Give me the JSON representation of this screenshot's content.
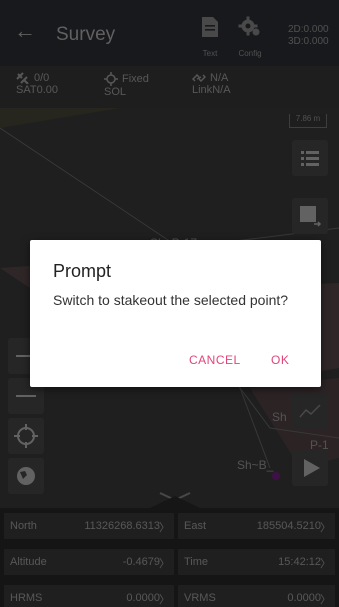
{
  "header": {
    "back_icon": "arrow-left-icon",
    "title": "Survey",
    "tools": [
      {
        "label": "Text",
        "icon": "document-icon"
      },
      {
        "label": "Config",
        "icon": "gear-icon"
      }
    ],
    "info_2d": "2D:0.000",
    "info_3d": "3D:0.000"
  },
  "status": {
    "sat_count": "0/0",
    "sat_label": "SAT",
    "sat_value": "0.00",
    "sol_state": "Fixed",
    "sol_label": "SOL",
    "link_value_top": "N/A",
    "link_label": "Link",
    "link_value": "N/A"
  },
  "map": {
    "scale": "7.86 m",
    "point_label_top": "Sh~P-17",
    "point_label_1": "Sh",
    "point_label_2": "P-1",
    "point_label_3": "Sh~B_",
    "colors": {
      "parcel_fill": "#5a4a4c",
      "point": "#7a1f8a"
    }
  },
  "dialog": {
    "title": "Prompt",
    "message": "Switch to stakeout the selected point?",
    "cancel_label": "CANCEL",
    "ok_label": "OK",
    "accent": "#e2457a"
  },
  "data_grid": [
    {
      "key": "North",
      "value": "11326268.6313"
    },
    {
      "key": "East",
      "value": "185504.5210"
    },
    {
      "key": "Altitude",
      "value": "-0.4679"
    },
    {
      "key": "Time",
      "value": "15:42:12"
    },
    {
      "key": "HRMS",
      "value": "0.0000"
    },
    {
      "key": "VRMS",
      "value": "0.0000"
    }
  ]
}
